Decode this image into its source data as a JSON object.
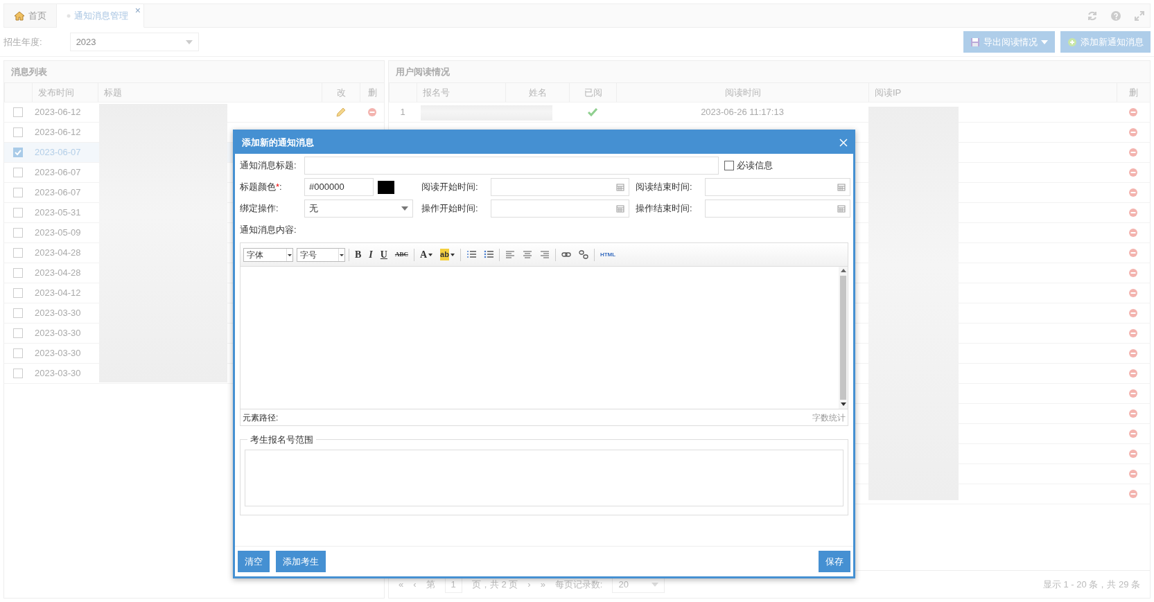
{
  "tabs": [
    {
      "label": "首页",
      "kind": "home",
      "selected": false
    },
    {
      "label": "通知消息管理",
      "kind": "page",
      "selected": true,
      "close": "×"
    }
  ],
  "filter": {
    "label": "招生年度:",
    "value": "2023"
  },
  "actions": [
    {
      "label": "导出阅读情况",
      "kind": "export"
    },
    {
      "label": "添加新通知消息",
      "kind": "add"
    }
  ],
  "message_list": {
    "title": "消息列表",
    "columns": [
      "发布时间",
      "标题",
      "改",
      "删"
    ],
    "rows": [
      {
        "date": "2023-06-12",
        "selected": false,
        "editable": true,
        "deletable": true
      },
      {
        "date": "2023-06-12",
        "selected": false,
        "editable": false,
        "deletable": false
      },
      {
        "date": "2023-06-07",
        "selected": true,
        "editable": false,
        "deletable": false
      },
      {
        "date": "2023-06-07",
        "selected": false,
        "editable": false,
        "deletable": false
      },
      {
        "date": "2023-06-07",
        "selected": false,
        "editable": false,
        "deletable": false
      },
      {
        "date": "2023-05-31",
        "selected": false,
        "editable": false,
        "deletable": false
      },
      {
        "date": "2023-05-09",
        "selected": false,
        "editable": false,
        "deletable": false
      },
      {
        "date": "2023-04-28",
        "selected": false,
        "editable": false,
        "deletable": false
      },
      {
        "date": "2023-04-28",
        "selected": false,
        "editable": false,
        "deletable": false
      },
      {
        "date": "2023-04-12",
        "selected": false,
        "editable": false,
        "deletable": false
      },
      {
        "date": "2023-03-30",
        "selected": false,
        "editable": false,
        "deletable": false
      },
      {
        "date": "2023-03-30",
        "selected": false,
        "editable": false,
        "deletable": false
      },
      {
        "date": "2023-03-30",
        "selected": false,
        "editable": false,
        "deletable": false
      },
      {
        "date": "2023-03-30",
        "selected": false,
        "editable": false,
        "deletable": false
      }
    ]
  },
  "read_list": {
    "title": "用户阅读情况",
    "columns": [
      "报名号",
      "姓名",
      "已阅",
      "阅读时间",
      "阅读IP",
      "删"
    ],
    "rows": [
      {
        "number": "1",
        "read": true,
        "time": "2023-06-26 11:17:13",
        "deletable": true
      },
      {
        "deletable": true
      },
      {
        "deletable": true
      },
      {
        "deletable": true
      },
      {
        "deletable": true
      },
      {
        "deletable": true
      },
      {
        "deletable": true
      },
      {
        "deletable": true
      },
      {
        "deletable": true
      },
      {
        "deletable": true
      },
      {
        "deletable": true
      },
      {
        "deletable": true
      },
      {
        "deletable": true
      },
      {
        "deletable": true
      },
      {
        "deletable": true
      },
      {
        "deletable": true
      },
      {
        "deletable": true
      },
      {
        "deletable": true
      },
      {
        "deletable": true
      },
      {
        "deletable": true
      }
    ],
    "pagination": {
      "first": "«",
      "prev": "‹",
      "page_prefix": "第",
      "page": "1",
      "page_suffix": "页，共 2 页",
      "next": "›",
      "last": "»",
      "per_page_label": "每页记录数:",
      "per_page": "20",
      "summary": "显示 1 - 20 条，共 29 条"
    }
  },
  "dialog": {
    "title": "添加新的通知消息",
    "title_field": {
      "label": "通知消息标题:"
    },
    "required_check": {
      "label": "必读信息",
      "checked": false
    },
    "color_field": {
      "label": "标题颜色",
      "required_mark": "*",
      "label_end": ":",
      "value": "#000000",
      "color": "#000000"
    },
    "bind_field": {
      "label": "绑定操作:",
      "value": "无"
    },
    "date_fields": [
      {
        "label": "阅读开始时间:"
      },
      {
        "label": "阅读结束时间:"
      },
      {
        "label": "操作开始时间:"
      },
      {
        "label": "操作结束时间:"
      }
    ],
    "content_label": "通知消息内容:",
    "editor": {
      "font_select": "字体",
      "size_select": "字号",
      "tools": [
        {
          "kind": "bold",
          "label": "B"
        },
        {
          "kind": "italic",
          "label": "I"
        },
        {
          "kind": "underline",
          "label": "U"
        },
        {
          "kind": "strike",
          "label": "ABC"
        },
        {
          "kind": "sep"
        },
        {
          "kind": "font-color",
          "label": "A"
        },
        {
          "kind": "highlight",
          "label": "ab"
        },
        {
          "kind": "sep"
        },
        {
          "kind": "ordered-list"
        },
        {
          "kind": "unordered-list"
        },
        {
          "kind": "sep"
        },
        {
          "kind": "align-left"
        },
        {
          "kind": "align-center"
        },
        {
          "kind": "align-right"
        },
        {
          "kind": "sep"
        },
        {
          "kind": "link"
        },
        {
          "kind": "unlink"
        },
        {
          "kind": "sep"
        },
        {
          "kind": "html",
          "label": "HTML"
        }
      ],
      "path_label": "元素路径:",
      "word_count": "字数统计"
    },
    "range_legend": "考生报名号范围",
    "left_buttons": [
      {
        "label": "清空"
      },
      {
        "label": "添加考生"
      }
    ],
    "right_buttons": [
      {
        "label": "保存"
      }
    ]
  }
}
